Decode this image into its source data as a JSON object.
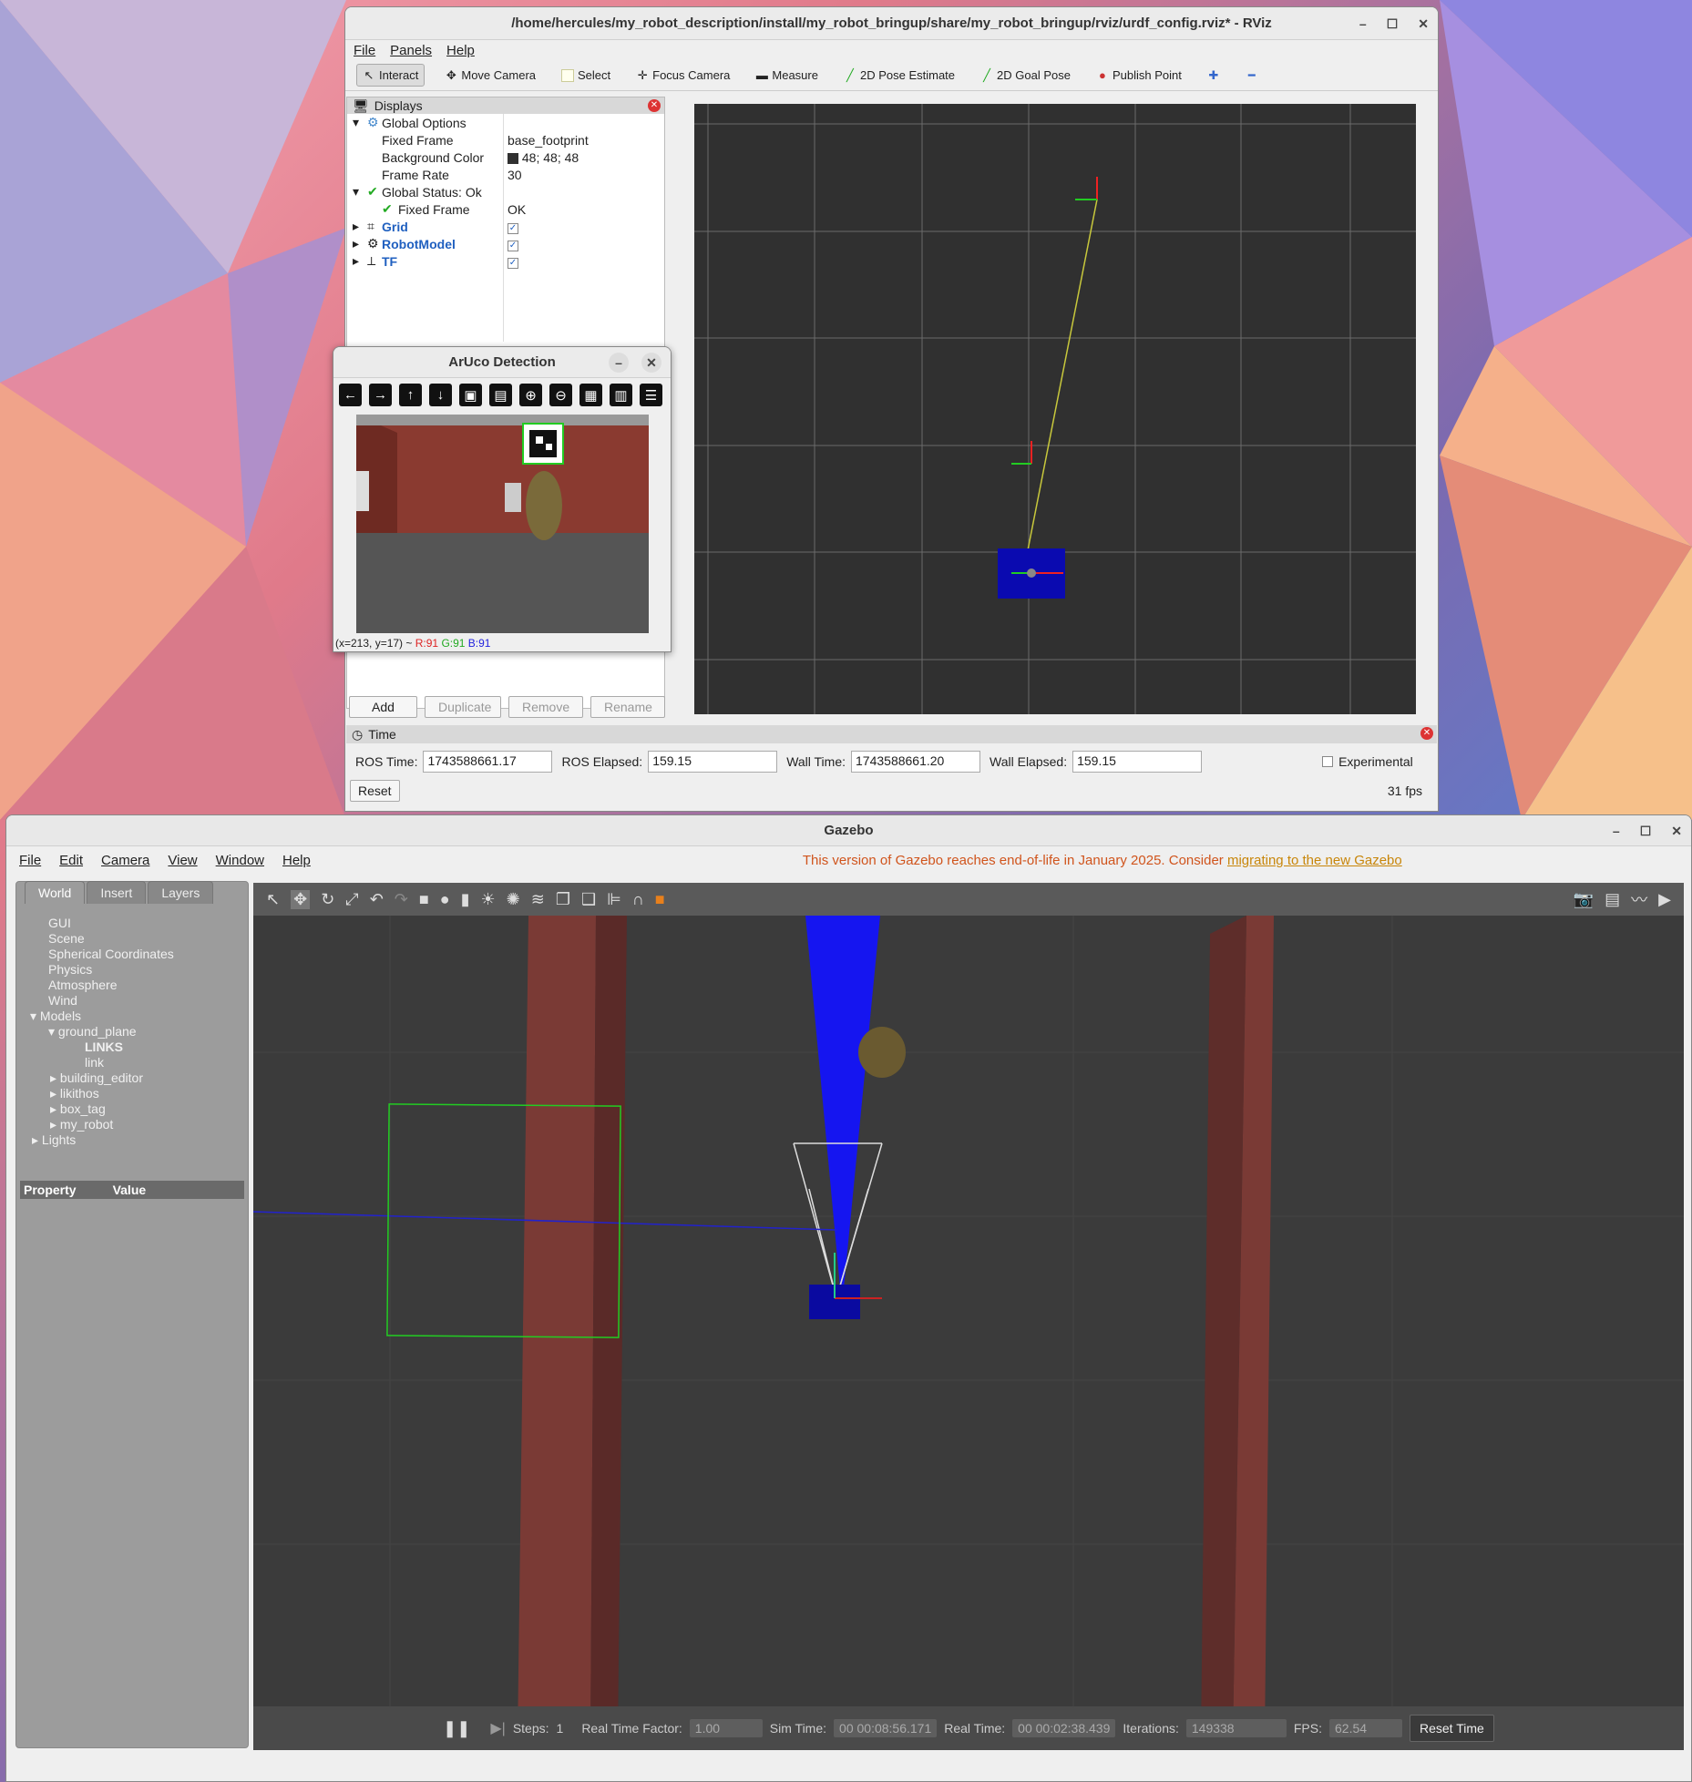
{
  "rviz": {
    "title": "/home/hercules/my_robot_description/install/my_robot_bringup/share/my_robot_bringup/rviz/urdf_config.rviz* - RViz",
    "menu": [
      "File",
      "Panels",
      "Help"
    ],
    "toolbar": [
      "Interact",
      "Move Camera",
      "Select",
      "Focus Camera",
      "Measure",
      "2D Pose Estimate",
      "2D Goal Pose",
      "Publish Point"
    ],
    "displays_title": "Displays",
    "global_options": "Global Options",
    "fixed_frame_label": "Fixed Frame",
    "fixed_frame_value": "base_footprint",
    "bg_color_label": "Background Color",
    "bg_color_value": "48; 48; 48",
    "frame_rate_label": "Frame Rate",
    "frame_rate_value": "30",
    "global_status": "Global Status: Ok",
    "status_fixed_frame": "Fixed Frame",
    "status_fixed_value": "OK",
    "grid": "Grid",
    "robot_model": "RobotModel",
    "tf": "TF",
    "buttons": {
      "add": "Add",
      "duplicate": "Duplicate",
      "remove": "Remove",
      "rename": "Rename"
    },
    "time_title": "Time",
    "ros_time_label": "ROS Time:",
    "ros_time": "1743588661.17",
    "ros_elapsed_label": "ROS Elapsed:",
    "ros_elapsed": "159.15",
    "wall_time_label": "Wall Time:",
    "wall_time": "1743588661.20",
    "wall_elapsed_label": "Wall Elapsed:",
    "wall_elapsed": "159.15",
    "experimental": "Experimental",
    "reset": "Reset",
    "fps": "31 fps"
  },
  "aruco": {
    "title": "ArUco Detection",
    "status_pos": "(x=213, y=17) ~",
    "r": "R:91",
    "g": "G:91",
    "b": "B:91"
  },
  "gazebo": {
    "title": "Gazebo",
    "menu": [
      "File",
      "Edit",
      "Camera",
      "View",
      "Window",
      "Help"
    ],
    "notice": "This version of Gazebo reaches end-of-life in January 2025. Consider ",
    "notice_link": "migrating to the new Gazebo",
    "tabs": [
      "World",
      "Insert",
      "Layers"
    ],
    "tree": [
      "GUI",
      "Scene",
      "Spherical Coordinates",
      "Physics",
      "Atmosphere",
      "Wind",
      "Models",
      "ground_plane",
      "LINKS",
      "link",
      "building_editor",
      "likithos",
      "box_tag",
      "my_robot",
      "Lights"
    ],
    "prop_header": "Property",
    "value_header": "Value",
    "steps_label": "Steps:",
    "steps": "1",
    "rtf_label": "Real Time Factor:",
    "rtf": "1.00",
    "sim_time_label": "Sim Time:",
    "sim_time": "00 00:08:56.171",
    "real_time_label": "Real Time:",
    "real_time": "00 00:02:38.439",
    "iterations_label": "Iterations:",
    "iterations": "149338",
    "fps_label": "FPS:",
    "fps": "62.54",
    "reset_time": "Reset Time"
  }
}
